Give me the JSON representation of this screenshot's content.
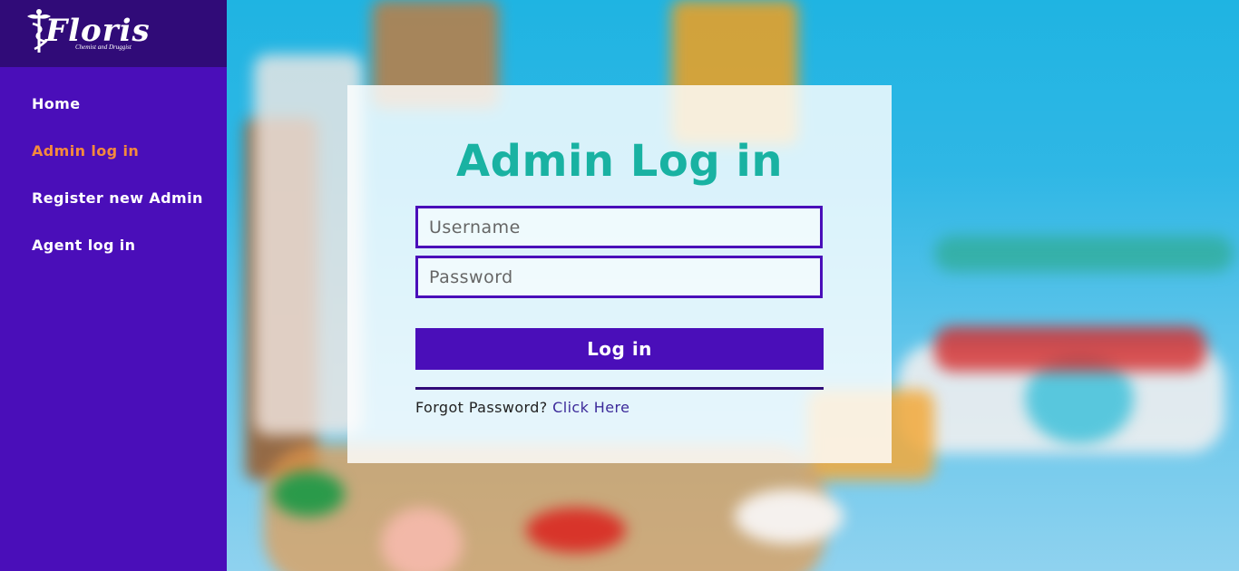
{
  "brand": {
    "name": "Floris",
    "tagline": "Chemist and Druggist"
  },
  "sidebar": {
    "items": [
      {
        "label": "Home"
      },
      {
        "label": "Admin log in"
      },
      {
        "label": "Register new Admin"
      },
      {
        "label": "Agent log in"
      }
    ]
  },
  "login": {
    "title": "Admin Log in",
    "username_placeholder": "Username",
    "password_placeholder": "Password",
    "submit_label": "Log in",
    "forgot_text": "Forgot Password?",
    "forgot_link": "Click Here"
  },
  "colors": {
    "sidebar": "#4a0eb9",
    "logo_bar": "#300b78",
    "active_nav": "#f58a3c",
    "title": "#19b2a2"
  },
  "icons": {
    "logo": "caduceus-icon"
  }
}
